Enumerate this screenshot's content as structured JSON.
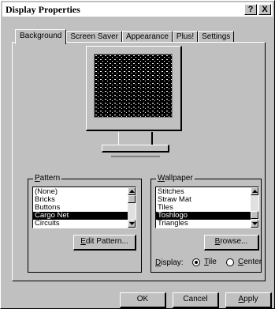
{
  "window": {
    "title": "Display Properties",
    "help_button": "?",
    "close_button": "X"
  },
  "tabs": [
    {
      "label": "Background"
    },
    {
      "label": "Screen Saver"
    },
    {
      "label": "Appearance"
    },
    {
      "label": "Plus!"
    },
    {
      "label": "Settings"
    }
  ],
  "pattern": {
    "group_label_accel": "P",
    "group_label_rest": "attern",
    "items": [
      "(None)",
      "Bricks",
      "Buttons",
      "Cargo Net",
      "Circuits"
    ],
    "selected": "Cargo Net",
    "edit_button_accel": "E",
    "edit_button_rest": "dit Pattern..."
  },
  "wallpaper": {
    "group_label_accel": "W",
    "group_label_rest": "allpaper",
    "items": [
      "Stitches",
      "Straw Mat",
      "Tiles",
      "Toshlogo",
      "Triangles"
    ],
    "selected": "Toshlogo",
    "browse_button_accel": "B",
    "browse_button_rest": "rowse...",
    "display_label_accel": "D",
    "display_label_rest": "isplay:",
    "tile_accel": "T",
    "tile_rest": "ile",
    "center_accel": "C",
    "center_rest": "enter",
    "display_mode": "Tile"
  },
  "footer": {
    "ok_label": "OK",
    "cancel_label": "Cancel",
    "apply_accel": "A",
    "apply_rest": "pply"
  }
}
